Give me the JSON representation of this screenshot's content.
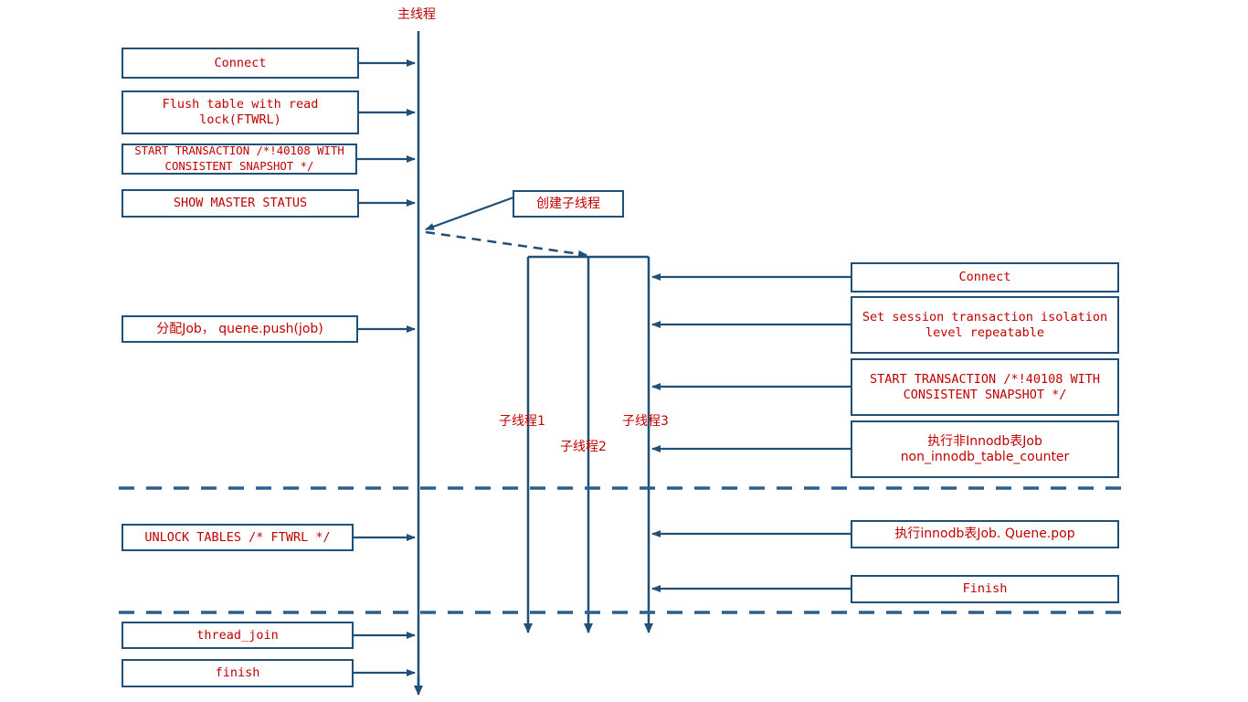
{
  "diagram": {
    "title_label": "主线程",
    "colors": {
      "line": "#205077",
      "text": "#c00000",
      "box_border": "#205077",
      "box_fill": "#ffffff",
      "background": "#ffffff"
    },
    "lane_labels": [
      {
        "name": "main-thread",
        "text": "主线程"
      },
      {
        "name": "child-thread-1",
        "text": "子线程1"
      },
      {
        "name": "child-thread-2",
        "text": "子线程2"
      },
      {
        "name": "child-thread-3",
        "text": "子线程3"
      }
    ],
    "left_boxes": [
      {
        "id": "connect",
        "text": "Connect"
      },
      {
        "id": "ftwrl",
        "text": "Flush table with read\nlock(FTWRL)"
      },
      {
        "id": "start-transaction",
        "text": "START TRANSACTION /*!40108 WITH\nCONSISTENT SNAPSHOT */"
      },
      {
        "id": "show-master-status",
        "text": "SHOW MASTER STATUS"
      },
      {
        "id": "assign-job",
        "text": "分配Job， quene.push(job)"
      },
      {
        "id": "unlock-tables",
        "text": "UNLOCK TABLES /* FTWRL */"
      },
      {
        "id": "thread-join",
        "text": "thread_join"
      },
      {
        "id": "finish",
        "text": "finish"
      }
    ],
    "center_box": {
      "id": "create-child-thread",
      "text": "创建子线程"
    },
    "right_boxes": [
      {
        "id": "connect",
        "text": "Connect"
      },
      {
        "id": "set-session-isolation",
        "text": "Set session transaction isolation\nlevel repeatable"
      },
      {
        "id": "start-transaction",
        "text": "START TRANSACTION /*!40108 WITH\nCONSISTENT SNAPSHOT */"
      },
      {
        "id": "non-innodb-job",
        "text": "执行非Innodb表Job\nnon_innodb_table_counter"
      },
      {
        "id": "innodb-job",
        "text": "执行innodb表Job. Quene.pop"
      },
      {
        "id": "finish",
        "text": "Finish"
      }
    ]
  }
}
